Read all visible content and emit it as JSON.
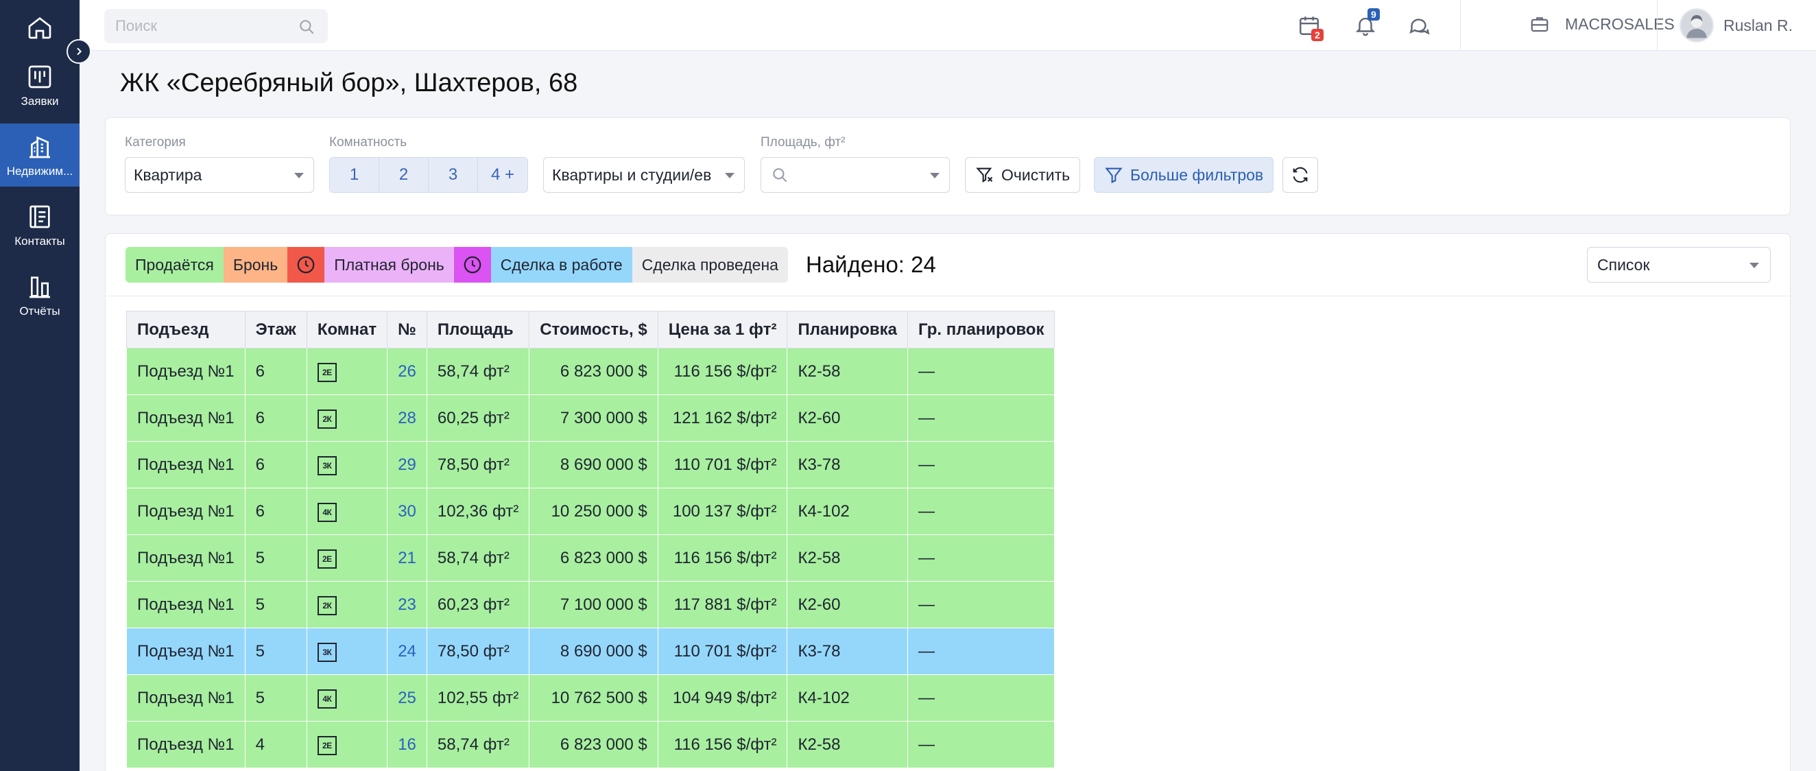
{
  "sidebar": {
    "items": [
      {
        "label": "",
        "icon": "home-icon"
      },
      {
        "label": "Заявки",
        "icon": "kanban-icon"
      },
      {
        "label": "Недвижим...",
        "icon": "buildings-icon",
        "active": true
      },
      {
        "label": "Контакты",
        "icon": "contacts-icon"
      },
      {
        "label": "Отчёты",
        "icon": "chart-icon"
      }
    ]
  },
  "topbar": {
    "search_placeholder": "Поиск",
    "calendar_badge": "2",
    "notifications_badge": "9",
    "company": "MACROSALES",
    "user": "Ruslan R."
  },
  "page": {
    "title": "ЖК «Серебряный бор», Шахтеров, 68"
  },
  "filters": {
    "category_label": "Категория",
    "category_value": "Квартира",
    "rooms_label": "Комнатность",
    "rooms": [
      "1",
      "2",
      "3",
      "4 +"
    ],
    "type_value": "Квартиры и студии/ев",
    "area_label": "Площадь, фт²",
    "clear": "Очистить",
    "more": "Больше фильтров"
  },
  "legend": {
    "sale": "Продаётся",
    "booking": "Бронь",
    "paid_booking": "Платная бронь",
    "deal_in_progress": "Сделка в работе",
    "deal_done": "Сделка проведена",
    "colors": {
      "sale": "#a8ef9f",
      "booking": "#fdb487",
      "booking_timer": "#f2584a",
      "paid": "#ebb2f7",
      "paid_timer": "#db53f2",
      "work": "#95d7fb",
      "done": "#ececec"
    }
  },
  "found": "Найдено: 24",
  "view": "Список",
  "table": {
    "headers": [
      "Подъезд",
      "Этаж",
      "Комнат",
      "№",
      "Площадь",
      "Стоимость, $",
      "Цена за 1 фт²",
      "Планировка",
      "Гр. планировок"
    ],
    "rows": [
      {
        "entrance": "Подъезд №1",
        "floor": "6",
        "rooms": "2Е",
        "no": "26",
        "area": "58,74 фт²",
        "price": "6 823 000 $",
        "ppm": "116 156 $/фт²",
        "plan": "К2-58",
        "group": "—",
        "status": "sale"
      },
      {
        "entrance": "Подъезд №1",
        "floor": "6",
        "rooms": "2К",
        "no": "28",
        "area": "60,25 фт²",
        "price": "7 300 000 $",
        "ppm": "121 162 $/фт²",
        "plan": "К2-60",
        "group": "—",
        "status": "sale"
      },
      {
        "entrance": "Подъезд №1",
        "floor": "6",
        "rooms": "3К",
        "no": "29",
        "area": "78,50 фт²",
        "price": "8 690 000 $",
        "ppm": "110 701 $/фт²",
        "plan": "К3-78",
        "group": "—",
        "status": "sale"
      },
      {
        "entrance": "Подъезд №1",
        "floor": "6",
        "rooms": "4К",
        "no": "30",
        "area": "102,36 фт²",
        "price": "10 250 000 $",
        "ppm": "100 137 $/фт²",
        "plan": "К4-102",
        "group": "—",
        "status": "sale"
      },
      {
        "entrance": "Подъезд №1",
        "floor": "5",
        "rooms": "2Е",
        "no": "21",
        "area": "58,74 фт²",
        "price": "6 823 000 $",
        "ppm": "116 156 $/фт²",
        "plan": "К2-58",
        "group": "—",
        "status": "sale"
      },
      {
        "entrance": "Подъезд №1",
        "floor": "5",
        "rooms": "2К",
        "no": "23",
        "area": "60,23 фт²",
        "price": "7 100 000 $",
        "ppm": "117 881 $/фт²",
        "plan": "К2-60",
        "group": "—",
        "status": "sale"
      },
      {
        "entrance": "Подъезд №1",
        "floor": "5",
        "rooms": "3К",
        "no": "24",
        "area": "78,50 фт²",
        "price": "8 690 000 $",
        "ppm": "110 701 $/фт²",
        "plan": "К3-78",
        "group": "—",
        "status": "work"
      },
      {
        "entrance": "Подъезд №1",
        "floor": "5",
        "rooms": "4К",
        "no": "25",
        "area": "102,55 фт²",
        "price": "10 762 500 $",
        "ppm": "104 949 $/фт²",
        "plan": "К4-102",
        "group": "—",
        "status": "sale"
      },
      {
        "entrance": "Подъезд №1",
        "floor": "4",
        "rooms": "2Е",
        "no": "16",
        "area": "58,74 фт²",
        "price": "6 823 000 $",
        "ppm": "116 156 $/фт²",
        "plan": "К2-58",
        "group": "—",
        "status": "sale"
      }
    ]
  }
}
